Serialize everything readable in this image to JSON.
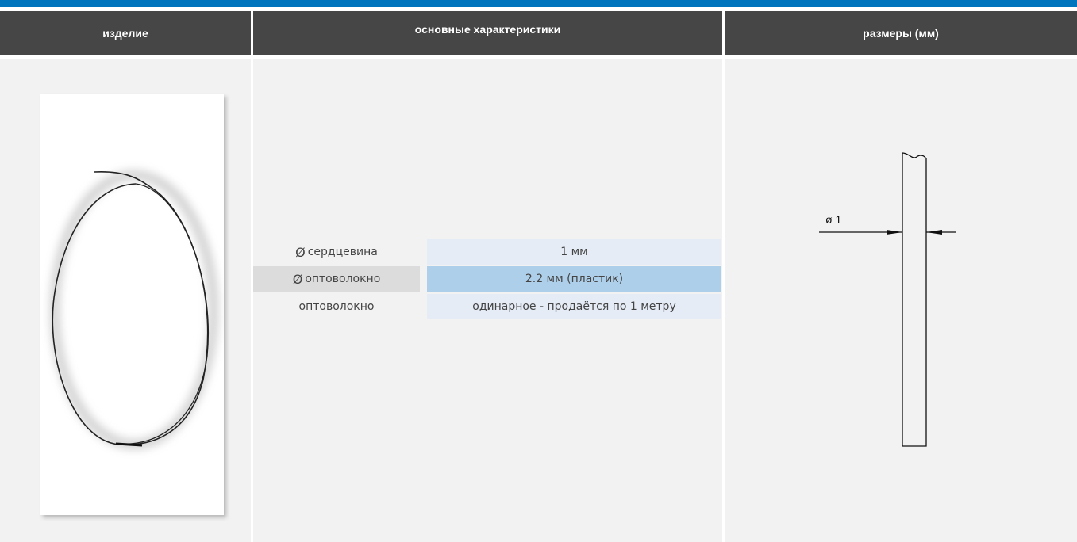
{
  "colors": {
    "accent_bar": "#0075bd",
    "header_bg": "#464646",
    "header_text": "#ffffff",
    "panel_bg": "#f2f2f2",
    "value_bg_light": "#e5ecf6",
    "value_bg_highlight": "#aecfe9",
    "label_bg_highlight": "#dcdcdc"
  },
  "header": {
    "col_product": "изделие",
    "col_specs": "основные характеристики",
    "col_dimensions": "размеры (мм)"
  },
  "product": {
    "icon": "coiled-optical-fiber-photo"
  },
  "specs": [
    {
      "symbol": "Ø",
      "label": "сердцевина",
      "value": "1 мм",
      "highlight": false
    },
    {
      "symbol": "Ø",
      "label": "оптоволокно",
      "value": "2.2 мм (пластик)",
      "highlight": true
    },
    {
      "symbol": "",
      "label": "оптоволокно",
      "value": "одинарное - продаётся по 1 метру",
      "highlight": false
    }
  ],
  "dimensions": {
    "diameter_label": "ø 1",
    "icon": "fiber-dimension-drawing"
  }
}
